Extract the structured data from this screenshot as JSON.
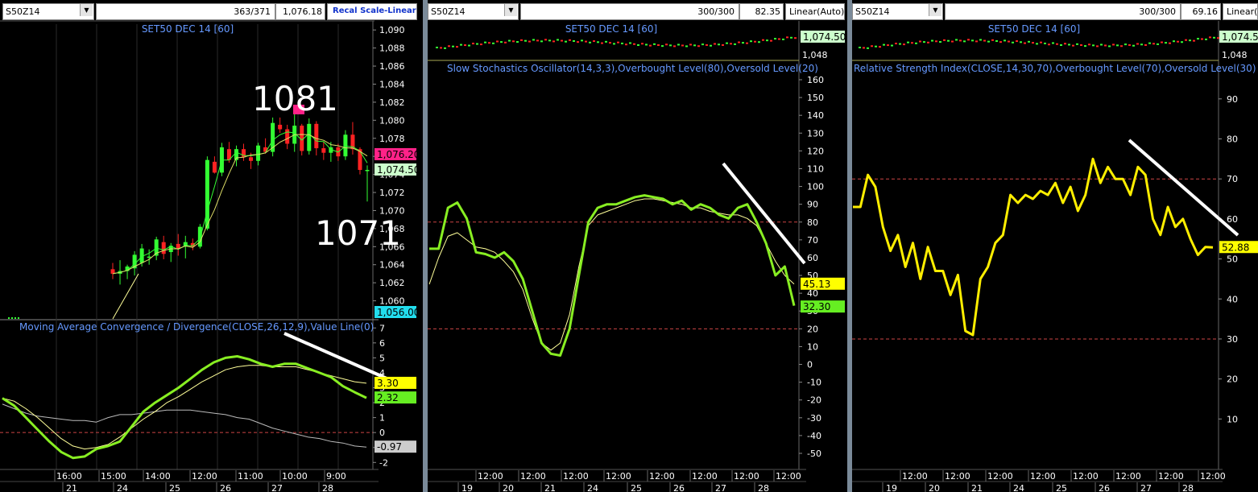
{
  "panels": [
    {
      "symbol": "S50Z14",
      "info": [
        "363/371",
        "1,076.18"
      ],
      "scale_label": "Recal Scale-Linear",
      "price_title": "SET50 DEC 14   [60]",
      "indicator_title": "Moving Average Convergence / Divergence(CLOSE,26,12,9),Value Line(0)",
      "price_ticks": [
        "1,090",
        "1,088",
        "1,086",
        "1,084",
        "1,082",
        "1,080",
        "1,078",
        "1,076",
        "1,074",
        "1,072",
        "1,070",
        "1,068",
        "1,066",
        "1,064",
        "1,062",
        "1,060"
      ],
      "indicator_ticks": [
        "7",
        "6",
        "5",
        "4",
        "3",
        "2",
        "1",
        "0",
        "-1",
        "-2"
      ],
      "price_tags": [
        "1,076.20",
        "1,074.50",
        "1,056.00"
      ],
      "indicator_tags": [
        "3.30",
        "2.32",
        "-0.97"
      ],
      "annotations": [
        "1081",
        "1071"
      ],
      "time_labels": [
        "16:00",
        "15:00",
        "14:00",
        "12:00",
        "11:00",
        "10:00",
        "9:00"
      ],
      "date_labels": [
        "21",
        "24",
        "25",
        "26",
        "27",
        "28"
      ]
    },
    {
      "symbol": "S50Z14",
      "info": [
        "300/300",
        "82.35"
      ],
      "scale_label": "Linear(Auto)",
      "price_title": "SET50 DEC 14   [60]",
      "indicator_title": "Slow Stochastics Oscillator(14,3,3),Overbought Level(80),Oversold Level(20)",
      "price_ticks": [
        "1,048"
      ],
      "indicator_ticks": [
        "160",
        "150",
        "140",
        "130",
        "120",
        "110",
        "100",
        "90",
        "80",
        "70",
        "60",
        "50",
        "40",
        "30",
        "20",
        "10",
        "0",
        "-10",
        "-20",
        "-30",
        "-40",
        "-50"
      ],
      "price_tags": [
        "1,074.50"
      ],
      "indicator_tags": [
        "45.13",
        "32.30"
      ],
      "time_labels": [
        "12:00",
        "12:00",
        "12:00",
        "12:00",
        "12:00",
        "12:00",
        "12:00",
        "12:00"
      ],
      "date_labels": [
        "19",
        "20",
        "21",
        "24",
        "25",
        "26",
        "27",
        "28"
      ]
    },
    {
      "symbol": "S50Z14",
      "info": [
        "300/300",
        "69.16"
      ],
      "scale_label": "Linear(Auto)",
      "price_title": "SET50 DEC 14   [60]",
      "indicator_title": "Relative Strength Index(CLOSE,14,30,70),Overbought Level(70),Oversold Level(30)",
      "price_ticks": [
        "1,048"
      ],
      "indicator_ticks": [
        "90",
        "80",
        "70",
        "60",
        "50",
        "40",
        "30",
        "20",
        "10"
      ],
      "price_tags": [
        "1,074.50"
      ],
      "indicator_tags": [
        "52.88"
      ],
      "time_labels": [
        "12:00",
        "12:00",
        "12:00",
        "12:00",
        "12:00",
        "12:00",
        "12:00",
        "12:00"
      ],
      "date_labels": [
        "19",
        "20",
        "21",
        "24",
        "25",
        "26",
        "27",
        "28"
      ]
    }
  ],
  "colors": {
    "up": "#33ff33",
    "down": "#ff2222",
    "title": "#6699ff",
    "fast": "#88ee22",
    "slow": "#ffff99",
    "rsi": "#ffee00",
    "level": "#cc4444",
    "trendline": "#ffffff"
  },
  "chart_data": [
    {
      "type": "candlestick",
      "title": "SET50 DEC 14   [60]",
      "ylim": [
        1058,
        1091
      ],
      "last_close": 1074.5,
      "annotations": {
        "high_label": 1081,
        "low_label": 1071
      },
      "candles": [
        [
          1063.5,
          1064.2,
          1062.4,
          1063.0
        ],
        [
          1063.0,
          1064.5,
          1061.8,
          1063.3
        ],
        [
          1063.3,
          1064.0,
          1062.4,
          1063.8
        ],
        [
          1063.6,
          1065.5,
          1062.8,
          1065.1
        ],
        [
          1064.2,
          1066.3,
          1063.8,
          1065.8
        ],
        [
          1064.8,
          1065.7,
          1064.0,
          1064.9
        ],
        [
          1065.0,
          1067.1,
          1064.5,
          1066.8
        ],
        [
          1066.5,
          1067.2,
          1064.6,
          1065.2
        ],
        [
          1065.4,
          1066.4,
          1064.3,
          1066.1
        ],
        [
          1066.3,
          1067.4,
          1065.0,
          1065.8
        ],
        [
          1066.0,
          1067.2,
          1064.7,
          1066.5
        ],
        [
          1066.4,
          1066.9,
          1065.6,
          1066.0
        ],
        [
          1066.0,
          1068.5,
          1065.8,
          1068.2
        ],
        [
          1068.0,
          1076.0,
          1067.8,
          1075.6
        ],
        [
          1075.4,
          1076.0,
          1074.1,
          1074.2
        ],
        [
          1074.2,
          1077.5,
          1073.8,
          1077.0
        ],
        [
          1076.8,
          1077.6,
          1075.3,
          1075.6
        ],
        [
          1075.6,
          1077.2,
          1074.9,
          1076.8
        ],
        [
          1076.8,
          1077.4,
          1075.5,
          1075.9
        ],
        [
          1075.9,
          1076.4,
          1074.6,
          1075.5
        ],
        [
          1075.5,
          1077.5,
          1075.0,
          1077.2
        ],
        [
          1077.0,
          1078.0,
          1076.3,
          1076.5
        ],
        [
          1076.5,
          1080.3,
          1076.0,
          1079.7
        ],
        [
          1079.5,
          1080.3,
          1078.6,
          1079.0
        ],
        [
          1079.0,
          1079.5,
          1076.8,
          1077.4
        ],
        [
          1077.4,
          1081.0,
          1076.5,
          1079.4
        ],
        [
          1079.4,
          1079.6,
          1076.1,
          1076.6
        ],
        [
          1076.6,
          1080.2,
          1076.2,
          1079.6
        ],
        [
          1079.6,
          1079.9,
          1076.1,
          1076.9
        ],
        [
          1076.9,
          1077.6,
          1075.6,
          1076.4
        ],
        [
          1076.4,
          1077.6,
          1075.4,
          1077.0
        ],
        [
          1077.0,
          1077.4,
          1075.5,
          1076.0
        ],
        [
          1076.0,
          1078.9,
          1075.6,
          1078.4
        ],
        [
          1078.4,
          1079.8,
          1076.2,
          1076.8
        ],
        [
          1076.8,
          1077.0,
          1074.0,
          1074.5
        ],
        [
          1074.5,
          1075.0,
          1071.0,
          1074.5
        ]
      ]
    },
    {
      "type": "line",
      "title": "Moving Average Convergence / Divergence(CLOSE,26,12,9),Value Line(0)",
      "ylim": [
        -2.2,
        7.5
      ],
      "series": [
        {
          "name": "MACD",
          "values": [
            2.3,
            1.8,
            1.0,
            0.2,
            -0.6,
            -1.3,
            -1.7,
            -1.6,
            -1.1,
            -0.9,
            -0.6,
            0.4,
            1.4,
            2.0,
            2.5,
            3.0,
            3.6,
            4.2,
            4.7,
            5.0,
            5.1,
            4.9,
            4.6,
            4.4,
            4.6,
            4.6,
            4.3,
            4.0,
            3.7,
            3.1,
            2.7,
            2.32
          ]
        },
        {
          "name": "Signal",
          "values": [
            2.3,
            2.1,
            1.6,
            1.0,
            0.3,
            -0.4,
            -0.9,
            -1.1,
            -1.0,
            -0.8,
            -0.3,
            0.3,
            0.9,
            1.4,
            2.0,
            2.4,
            2.9,
            3.4,
            3.8,
            4.2,
            4.4,
            4.5,
            4.5,
            4.4,
            4.4,
            4.4,
            4.2,
            4.0,
            3.8,
            3.6,
            3.4,
            3.3
          ]
        },
        {
          "name": "Value Line",
          "values": [
            1.9,
            1.6,
            1.3,
            1.1,
            1.0,
            0.9,
            0.8,
            0.8,
            0.7,
            1.0,
            1.2,
            1.2,
            1.3,
            1.4,
            1.5,
            1.5,
            1.5,
            1.4,
            1.3,
            1.2,
            1.0,
            0.9,
            0.6,
            0.3,
            0.1,
            -0.1,
            -0.3,
            -0.4,
            -0.6,
            -0.7,
            -0.9,
            -0.97
          ]
        }
      ],
      "zero_line": 0
    },
    {
      "type": "line",
      "title": "Slow Stochastics Oscillator(14,3,3),Overbought Level(80),Oversold Level(20)",
      "ylim": [
        -50,
        160
      ],
      "series": [
        {
          "name": "%K",
          "values": [
            65,
            65,
            88,
            91,
            82,
            63,
            62,
            60,
            63,
            58,
            48,
            30,
            12,
            6,
            5,
            20,
            50,
            80,
            88,
            90,
            90,
            92,
            94,
            95,
            94,
            93,
            90,
            92,
            87,
            90,
            88,
            84,
            82,
            88,
            90,
            80,
            68,
            50,
            55,
            33
          ]
        },
        {
          "name": "%D",
          "values": [
            45,
            60,
            72,
            74,
            70,
            66,
            65,
            63,
            58,
            52,
            42,
            26,
            12,
            8,
            12,
            28,
            55,
            78,
            84,
            86,
            88,
            90,
            92,
            93,
            93,
            92,
            91,
            90,
            88,
            88,
            86,
            85,
            84,
            84,
            82,
            78,
            68,
            58,
            50,
            45.13
          ]
        }
      ],
      "levels": [
        80,
        20
      ]
    },
    {
      "type": "line",
      "title": "Relative Strength Index(CLOSE,14,30,70),Overbought Level(70),Oversold Level(30)",
      "ylim": [
        0,
        96
      ],
      "series": [
        {
          "name": "RSI",
          "values": [
            63,
            63,
            71,
            68,
            58,
            52,
            56,
            48,
            54,
            45,
            53,
            47,
            47,
            41,
            46,
            32,
            31,
            45,
            48,
            54,
            56,
            66,
            64,
            66,
            65,
            67,
            66,
            69,
            64,
            68,
            62,
            66,
            75,
            69,
            73,
            70,
            70,
            66,
            73,
            71,
            60,
            56,
            63,
            58,
            60,
            55,
            51,
            53,
            52.88
          ]
        }
      ],
      "levels": [
        70,
        30
      ]
    }
  ]
}
